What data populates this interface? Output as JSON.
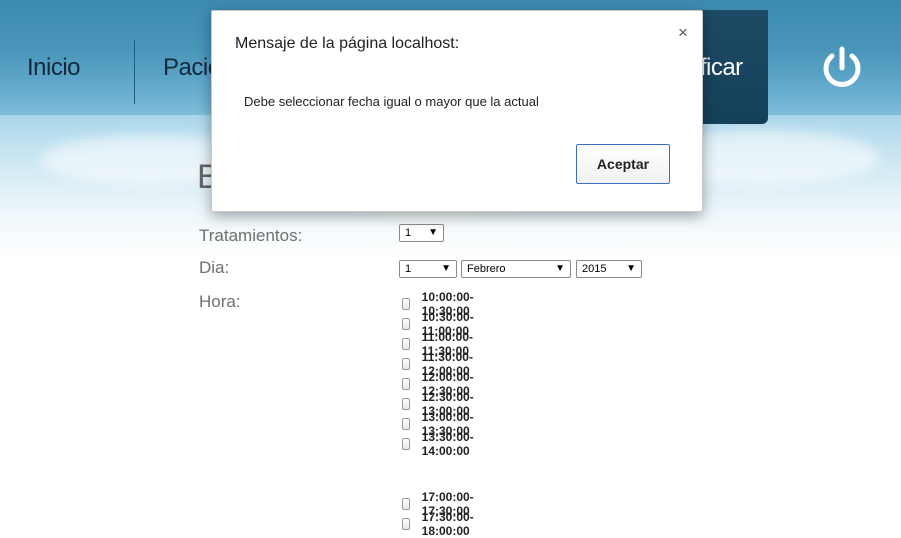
{
  "nav": {
    "items": [
      "Inicio",
      "Pacie",
      "ificar"
    ]
  },
  "form": {
    "heading_partial": "B",
    "labels": {
      "tratamientos": "Tratamientos:",
      "dia": "Dia:",
      "hora": "Hora:"
    },
    "tratamientos_value": "1",
    "dia_value": "1",
    "mes_value": "Febrero",
    "anio_value": "2015",
    "hours": [
      "10:00:00-10:30:00",
      "10:30:00-11:00:00",
      "11:00:00-11:30:00",
      "11:30:00-12:00:00",
      "12:00:00-12:30:00",
      "12:30:00-13:00:00",
      "13:00:00-13:30:00",
      "13:30:00-14:00:00",
      "17:00:00-17:30:00",
      "17:30:00-18:00:00"
    ]
  },
  "dialog": {
    "title": "Mensaje de la página localhost:",
    "close_glyph": "×",
    "message": "Debe seleccionar fecha igual o mayor que la actual",
    "accept_label": "Aceptar"
  },
  "glyphs": {
    "dropdown_arrow": "▼"
  },
  "colors": {
    "nav_top": "#3c8ab0",
    "nav_active": "#1e4a66",
    "dialog_button_border": "#3b6fc4"
  },
  "icons": {
    "power": "power-icon"
  }
}
